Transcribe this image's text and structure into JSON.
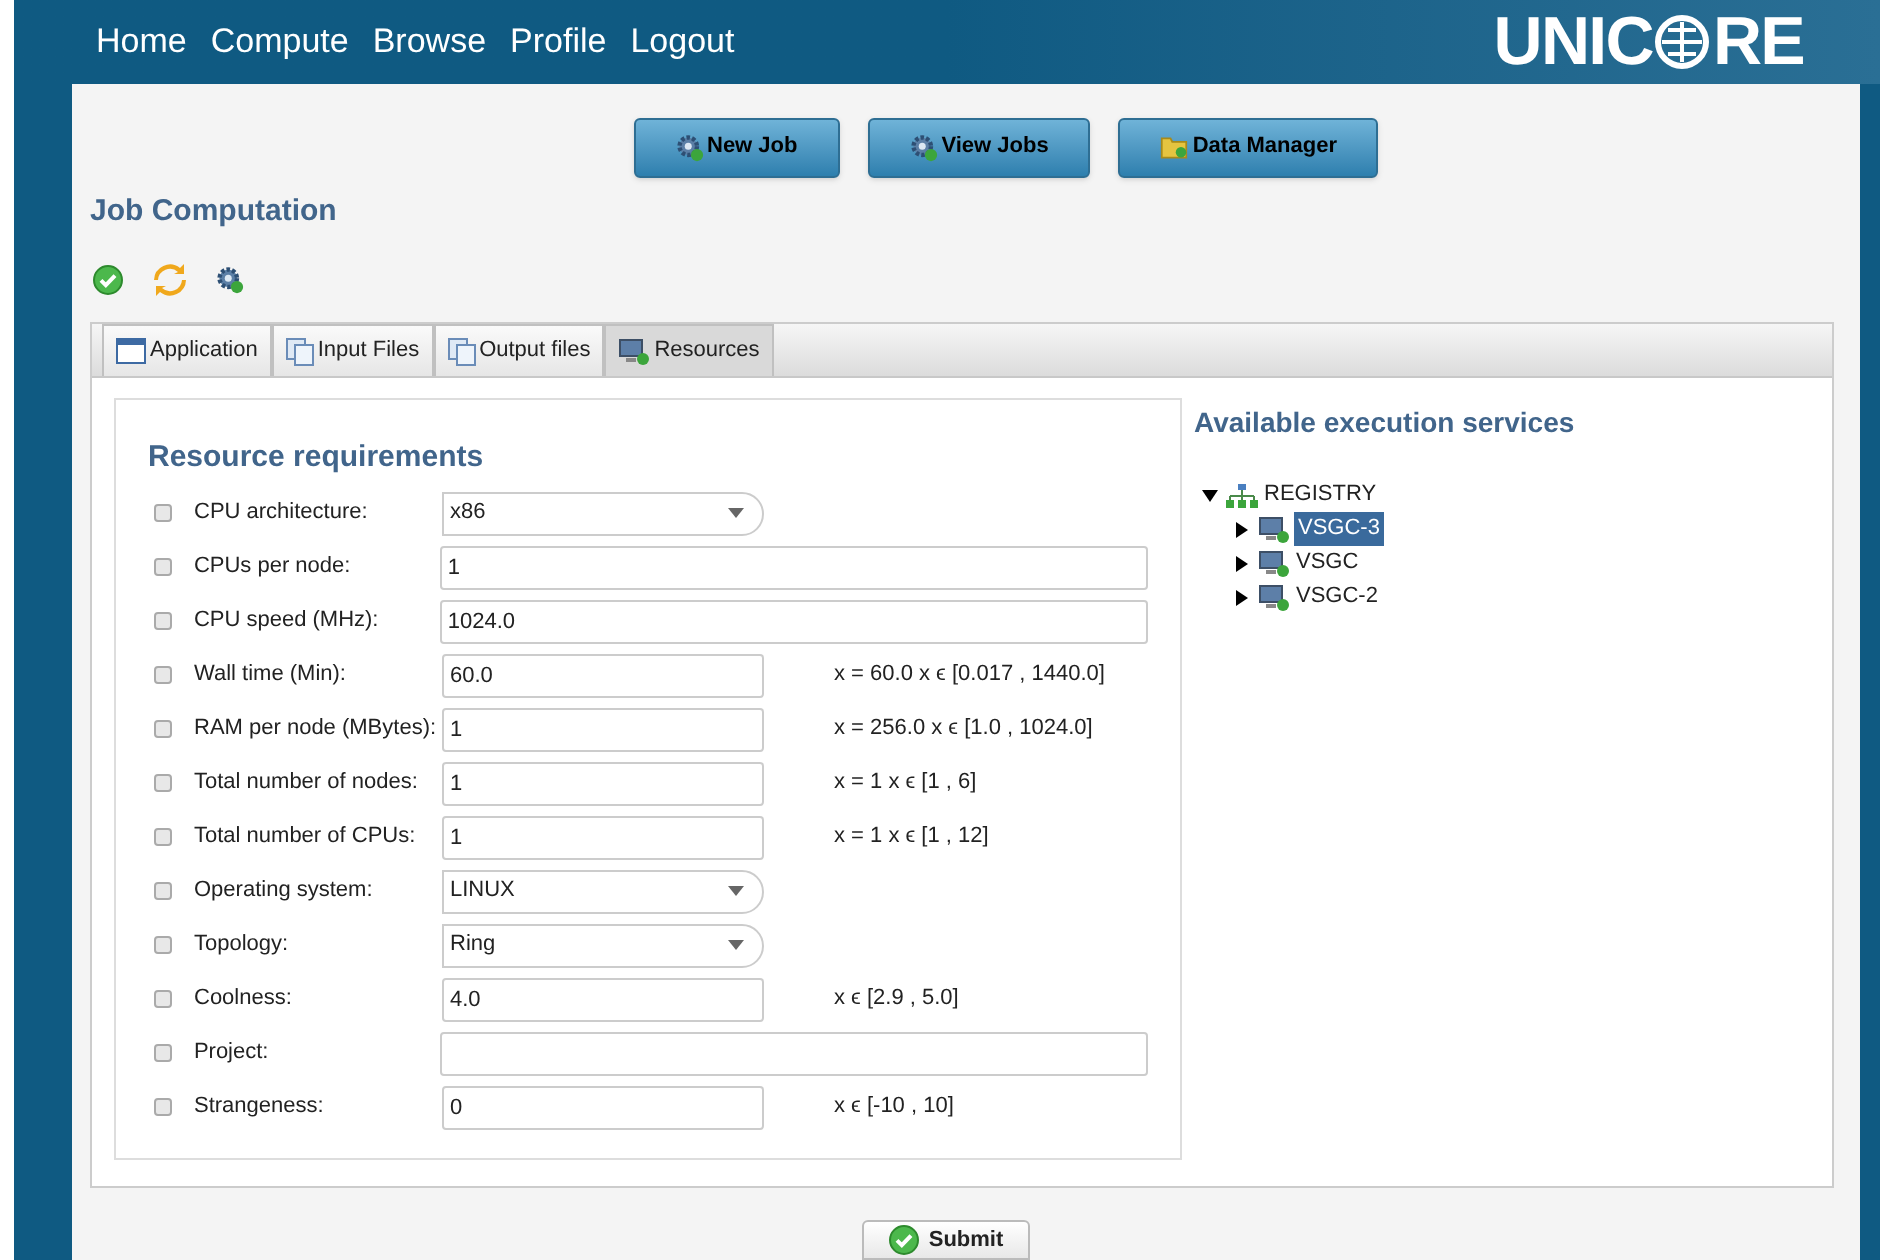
{
  "nav": {
    "items": [
      "Home",
      "Compute",
      "Browse",
      "Profile",
      "Logout"
    ],
    "logo": [
      "UNIC",
      "RE"
    ]
  },
  "toolbar_buttons": [
    {
      "label": "New Job",
      "kind": "gear"
    },
    {
      "label": "View Jobs",
      "kind": "gear"
    },
    {
      "label": "Data Manager",
      "kind": "folder"
    }
  ],
  "title": "Job Computation",
  "tabs": [
    {
      "label": "Application",
      "selected": false,
      "kind": "window"
    },
    {
      "label": "Input Files",
      "selected": false,
      "kind": "files"
    },
    {
      "label": "Output files",
      "selected": false,
      "kind": "files"
    },
    {
      "label": "Resources",
      "selected": true,
      "kind": "computer"
    }
  ],
  "resources": {
    "title": "Resource requirements",
    "rows": [
      {
        "label": "CPU architecture:",
        "checked": false,
        "kind": "select",
        "value": "x86"
      },
      {
        "label": "CPUs per node:",
        "checked": false,
        "kind": "wide",
        "value": "1"
      },
      {
        "label": "CPU speed (MHz):",
        "checked": false,
        "kind": "wide",
        "value": "1024.0"
      },
      {
        "label": "Wall time (Min):",
        "checked": false,
        "kind": "short",
        "value": "60.0",
        "hint": "x = 60.0 x ϵ [0.017 , 1440.0]"
      },
      {
        "label": "RAM per node (MBytes):",
        "checked": false,
        "kind": "short",
        "value": "1",
        "hint": "x = 256.0 x ϵ [1.0 , 1024.0]"
      },
      {
        "label": "Total number of nodes:",
        "checked": false,
        "kind": "short",
        "value": "1",
        "hint": "x = 1 x ϵ [1 , 6]"
      },
      {
        "label": "Total number of CPUs:",
        "checked": false,
        "kind": "short",
        "value": "1",
        "hint": "x = 1 x ϵ [1 , 12]"
      },
      {
        "label": "Operating system:",
        "checked": false,
        "kind": "select",
        "value": "LINUX"
      },
      {
        "label": "Topology:",
        "checked": false,
        "kind": "select",
        "value": "Ring"
      },
      {
        "label": "Coolness:",
        "checked": false,
        "kind": "short",
        "value": "4.0",
        "hint": "x ϵ [2.9 , 5.0]"
      },
      {
        "label": "Project:",
        "checked": false,
        "kind": "wide"
      },
      {
        "label": "Strangeness:",
        "checked": false,
        "kind": "short",
        "value": "0",
        "hint": "x ϵ [-10 , 10]"
      }
    ]
  },
  "services": {
    "title": "Available execution services",
    "tree": [
      {
        "label": "REGISTRY",
        "expanded": true,
        "selected": false,
        "children": [
          {
            "label": "VSGC-3",
            "expanded": false,
            "selected": true
          },
          {
            "label": "VSGC",
            "expanded": false,
            "selected": false
          },
          {
            "label": "VSGC-2",
            "expanded": false,
            "selected": false
          }
        ]
      }
    ]
  },
  "submit": "Submit"
}
